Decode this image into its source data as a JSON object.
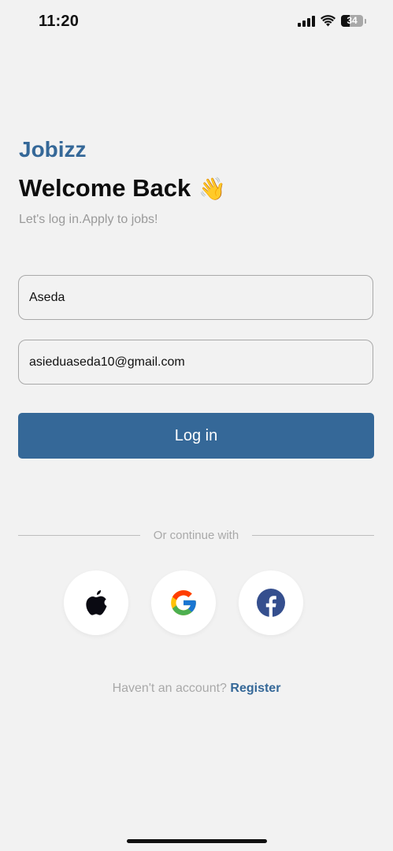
{
  "status_bar": {
    "time": "11:20",
    "battery_level": "34",
    "icons": [
      "signal-icon",
      "wifi-icon",
      "battery-icon"
    ]
  },
  "header": {
    "brand": "Jobizz",
    "title": "Welcome Back",
    "title_emoji": "👋",
    "subtitle": "Let's log in.Apply to jobs!"
  },
  "form": {
    "username_value": "Aseda",
    "email_value": "asieduaseda10@gmail.com",
    "login_label": "Log in"
  },
  "social": {
    "divider_text": "Or continue with",
    "providers": [
      "apple-icon",
      "google-icon",
      "facebook-icon"
    ]
  },
  "footer": {
    "prompt": "Haven't an account?",
    "register_label": "Register"
  },
  "colors": {
    "brand": "#356898",
    "background": "#f2f2f2",
    "muted_text": "#9a9a9a"
  }
}
